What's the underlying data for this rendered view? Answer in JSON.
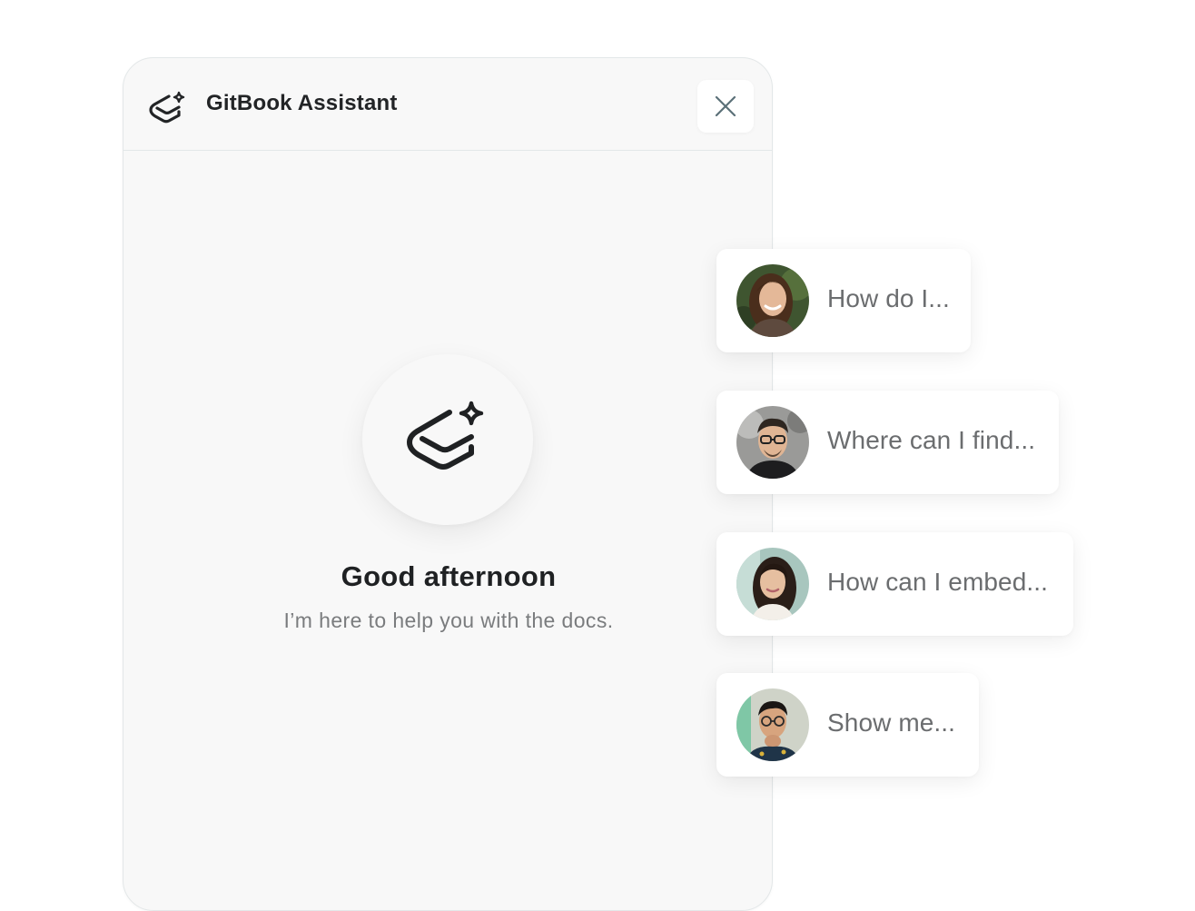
{
  "assistant": {
    "title": "GitBook Assistant",
    "logo_icon": "gitbook-assistant-icon",
    "close_icon": "close-icon",
    "greeting": "Good afternoon",
    "subtitle": "I’m here to help you with the docs."
  },
  "suggestions": [
    {
      "text": "How do I...",
      "avatar": "avatar-woman-brown-hair"
    },
    {
      "text": "Where can I find...",
      "avatar": "avatar-man-glasses"
    },
    {
      "text": "How can I embed...",
      "avatar": "avatar-woman-dark-hair"
    },
    {
      "text": "Show me...",
      "avatar": "avatar-man-glasses-hand"
    }
  ],
  "colors": {
    "panel_background": "#f8f8f8",
    "panel_border": "#e3e7e8",
    "title_text": "#222426",
    "muted_text": "#7a7c7e",
    "close_icon": "#5b7078"
  }
}
